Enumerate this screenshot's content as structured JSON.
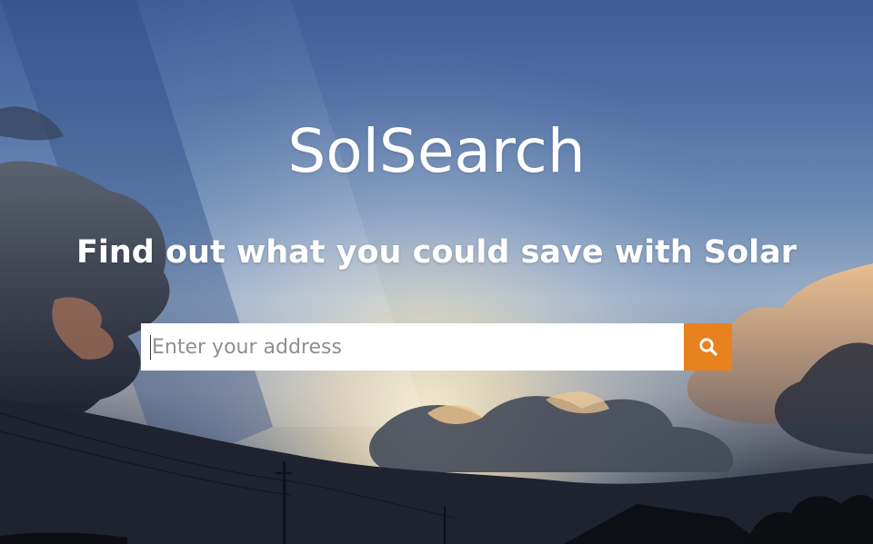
{
  "brand": {
    "title": "SolSearch",
    "tagline": "Find out what you could save with Solar"
  },
  "search": {
    "placeholder": "Enter your address",
    "value": "",
    "button_icon": "search-icon"
  },
  "colors": {
    "accent": "#e8821f",
    "text": "#ffffff",
    "sky_top": "#3f5d95"
  }
}
